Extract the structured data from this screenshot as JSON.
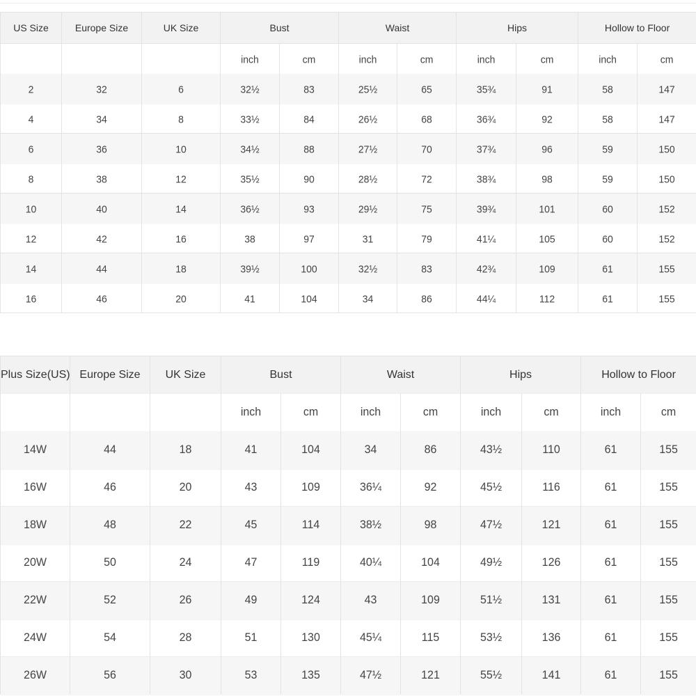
{
  "table1": {
    "headers": [
      "US Size",
      "Europe Size",
      "UK Size",
      "Bust",
      "Waist",
      "Hips",
      "Hollow to Floor"
    ],
    "units": [
      "inch",
      "cm"
    ],
    "rows": [
      [
        "2",
        "32",
        "6",
        "32½",
        "83",
        "25½",
        "65",
        "35¾",
        "91",
        "58",
        "147"
      ],
      [
        "4",
        "34",
        "8",
        "33½",
        "84",
        "26½",
        "68",
        "36¾",
        "92",
        "58",
        "147"
      ],
      [
        "6",
        "36",
        "10",
        "34½",
        "88",
        "27½",
        "70",
        "37¾",
        "96",
        "59",
        "150"
      ],
      [
        "8",
        "38",
        "12",
        "35½",
        "90",
        "28½",
        "72",
        "38¾",
        "98",
        "59",
        "150"
      ],
      [
        "10",
        "40",
        "14",
        "36½",
        "93",
        "29½",
        "75",
        "39¾",
        "101",
        "60",
        "152"
      ],
      [
        "12",
        "42",
        "16",
        "38",
        "97",
        "31",
        "79",
        "41¼",
        "105",
        "60",
        "152"
      ],
      [
        "14",
        "44",
        "18",
        "39½",
        "100",
        "32½",
        "83",
        "42¾",
        "109",
        "61",
        "155"
      ],
      [
        "16",
        "46",
        "20",
        "41",
        "104",
        "34",
        "86",
        "44¼",
        "112",
        "61",
        "155"
      ]
    ]
  },
  "table2": {
    "headers": [
      "Plus Size(US)",
      "Europe Size",
      "UK Size",
      "Bust",
      "Waist",
      "Hips",
      "Hollow to Floor"
    ],
    "units": [
      "inch",
      "cm"
    ],
    "rows": [
      [
        "14W",
        "44",
        "18",
        "41",
        "104",
        "34",
        "86",
        "43½",
        "110",
        "61",
        "155"
      ],
      [
        "16W",
        "46",
        "20",
        "43",
        "109",
        "36¼",
        "92",
        "45½",
        "116",
        "61",
        "155"
      ],
      [
        "18W",
        "48",
        "22",
        "45",
        "114",
        "38½",
        "98",
        "47½",
        "121",
        "61",
        "155"
      ],
      [
        "20W",
        "50",
        "24",
        "47",
        "119",
        "40¼",
        "104",
        "49½",
        "126",
        "61",
        "155"
      ],
      [
        "22W",
        "52",
        "26",
        "49",
        "124",
        "43",
        "109",
        "51½",
        "131",
        "61",
        "155"
      ],
      [
        "24W",
        "54",
        "28",
        "51",
        "130",
        "45¼",
        "115",
        "53½",
        "136",
        "61",
        "155"
      ],
      [
        "26W",
        "56",
        "30",
        "53",
        "135",
        "47½",
        "121",
        "55½",
        "141",
        "61",
        "155"
      ]
    ]
  }
}
